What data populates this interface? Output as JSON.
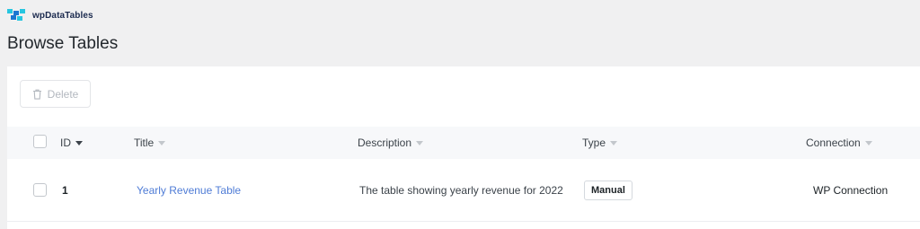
{
  "brand": {
    "name": "wpDataTables",
    "accent": "#1b76d1"
  },
  "page": {
    "title": "Browse Tables"
  },
  "toolbar": {
    "delete_label": "Delete"
  },
  "table": {
    "columns": [
      {
        "label": "ID",
        "sorted": true
      },
      {
        "label": "Title"
      },
      {
        "label": "Description"
      },
      {
        "label": "Type"
      },
      {
        "label": "Connection"
      }
    ],
    "rows": [
      {
        "id": "1",
        "title": "Yearly Revenue Table",
        "description": "The table showing yearly revenue for 2022",
        "type": "Manual",
        "connection": "WP Connection"
      }
    ]
  },
  "colors": {
    "link": "#4f7cd6",
    "background": "#f0f0f1",
    "header_row": "#f7f8fa"
  }
}
